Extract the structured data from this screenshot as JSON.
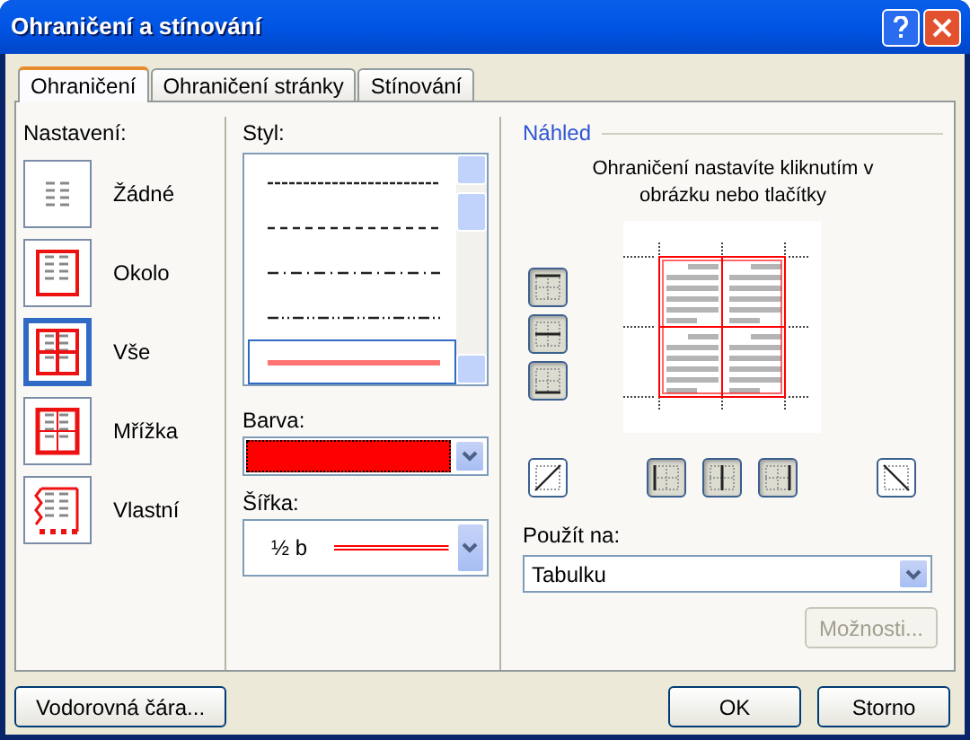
{
  "window": {
    "title": "Ohraničení a stínování"
  },
  "tabs": [
    {
      "label": "Ohraničení",
      "selected": true
    },
    {
      "label": "Ohraničení stránky",
      "selected": false
    },
    {
      "label": "Stínování",
      "selected": false
    }
  ],
  "settings": {
    "label": "Nastavení:",
    "items": [
      {
        "kind": "none",
        "label": "Žádné",
        "selected": false
      },
      {
        "kind": "box",
        "label": "Okolo",
        "selected": false
      },
      {
        "kind": "all",
        "label": "Vše",
        "selected": true
      },
      {
        "kind": "grid",
        "label": "Mřížka",
        "selected": false
      },
      {
        "kind": "custom",
        "label": "Vlastní",
        "selected": false
      }
    ]
  },
  "style": {
    "label": "Styl:",
    "items": [
      {
        "kind": "fine-dash",
        "selected": false
      },
      {
        "kind": "dash",
        "selected": false
      },
      {
        "kind": "dash-dot",
        "selected": false
      },
      {
        "kind": "dash-dot-dot",
        "selected": false
      },
      {
        "kind": "solid",
        "selected": true
      }
    ]
  },
  "color": {
    "label": "Barva:",
    "color": "#ff0000"
  },
  "width": {
    "label": "Šířka:",
    "value": "½ b"
  },
  "preview": {
    "title": "Náhled",
    "hint": "Ohraničení nastavíte kliknutím v obrázku nebo tlačítky",
    "side_buttons": [
      {
        "kind": "top",
        "on": true
      },
      {
        "kind": "middle",
        "on": true
      },
      {
        "kind": "bottom",
        "on": true
      }
    ],
    "bottom_buttons": [
      {
        "kind": "diag-up",
        "on": false
      },
      {
        "kind": "left",
        "on": true
      },
      {
        "kind": "center",
        "on": true
      },
      {
        "kind": "right",
        "on": true
      },
      {
        "kind": "diag-down",
        "on": false
      }
    ]
  },
  "apply_to": {
    "label": "Použít na:",
    "value": "Tabulku"
  },
  "options_button": {
    "label": "Možnosti...",
    "disabled": true
  },
  "buttons": {
    "horizontal_line": "Vodorovná čára...",
    "ok": "OK",
    "cancel": "Storno"
  }
}
